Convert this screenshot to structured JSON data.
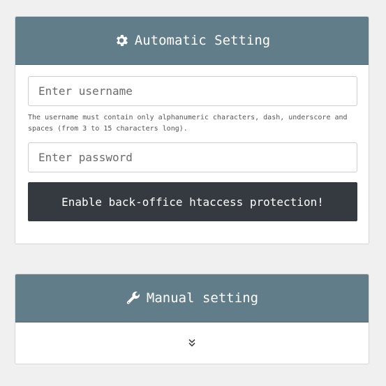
{
  "auto": {
    "title": "Automatic Setting",
    "icon": "gear-icon",
    "username": {
      "placeholder": "Enter username",
      "value": ""
    },
    "help": "The username must contain only alphanumeric characters, dash, underscore and spaces (from 3 to 15 characters long).",
    "password": {
      "placeholder": "Enter password",
      "value": ""
    },
    "submit_label": "Enable back-office htaccess protection!"
  },
  "manual": {
    "title": "Manual setting",
    "icon": "wrench-icon",
    "expand_icon": "double-chevron-down-icon"
  },
  "colors": {
    "header": "#627d8a",
    "button": "#353a40",
    "background": "#f0f0f0"
  }
}
